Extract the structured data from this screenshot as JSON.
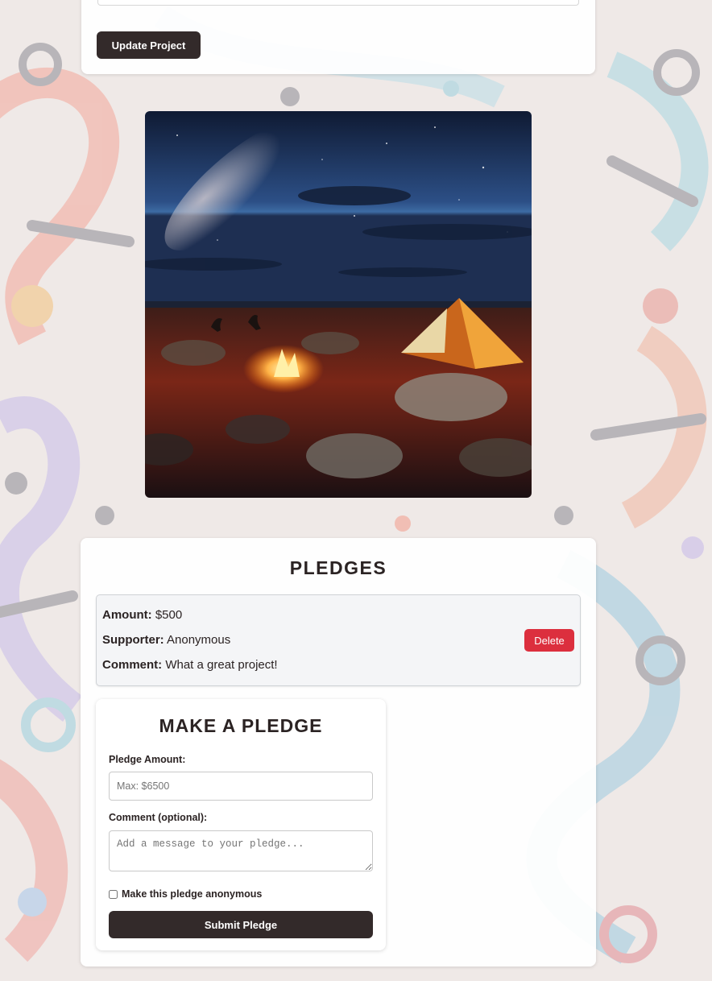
{
  "project_form": {
    "update_button_label": "Update Project"
  },
  "hero_image": {
    "description": "desert-campsite-night-sky"
  },
  "pledges": {
    "title": "PLEDGES",
    "items": [
      {
        "amount_label": "Amount:",
        "amount_value": "$500",
        "supporter_label": "Supporter:",
        "supporter_value": "Anonymous",
        "comment_label": "Comment:",
        "comment_value": "What a great project!",
        "delete_label": "Delete"
      }
    ]
  },
  "pledge_form": {
    "title": "MAKE A PLEDGE",
    "amount_label": "Pledge Amount:",
    "amount_placeholder": "Max: $6500",
    "comment_label": "Comment (optional):",
    "comment_placeholder": "Add a message to your pledge...",
    "anonymous_label": "Make this pledge anonymous",
    "anonymous_checked": false,
    "submit_label": "Submit Pledge"
  },
  "colors": {
    "primary_dark": "#332a2a",
    "delete_red": "#dc2f3e",
    "card_bg": "#ffffff"
  }
}
